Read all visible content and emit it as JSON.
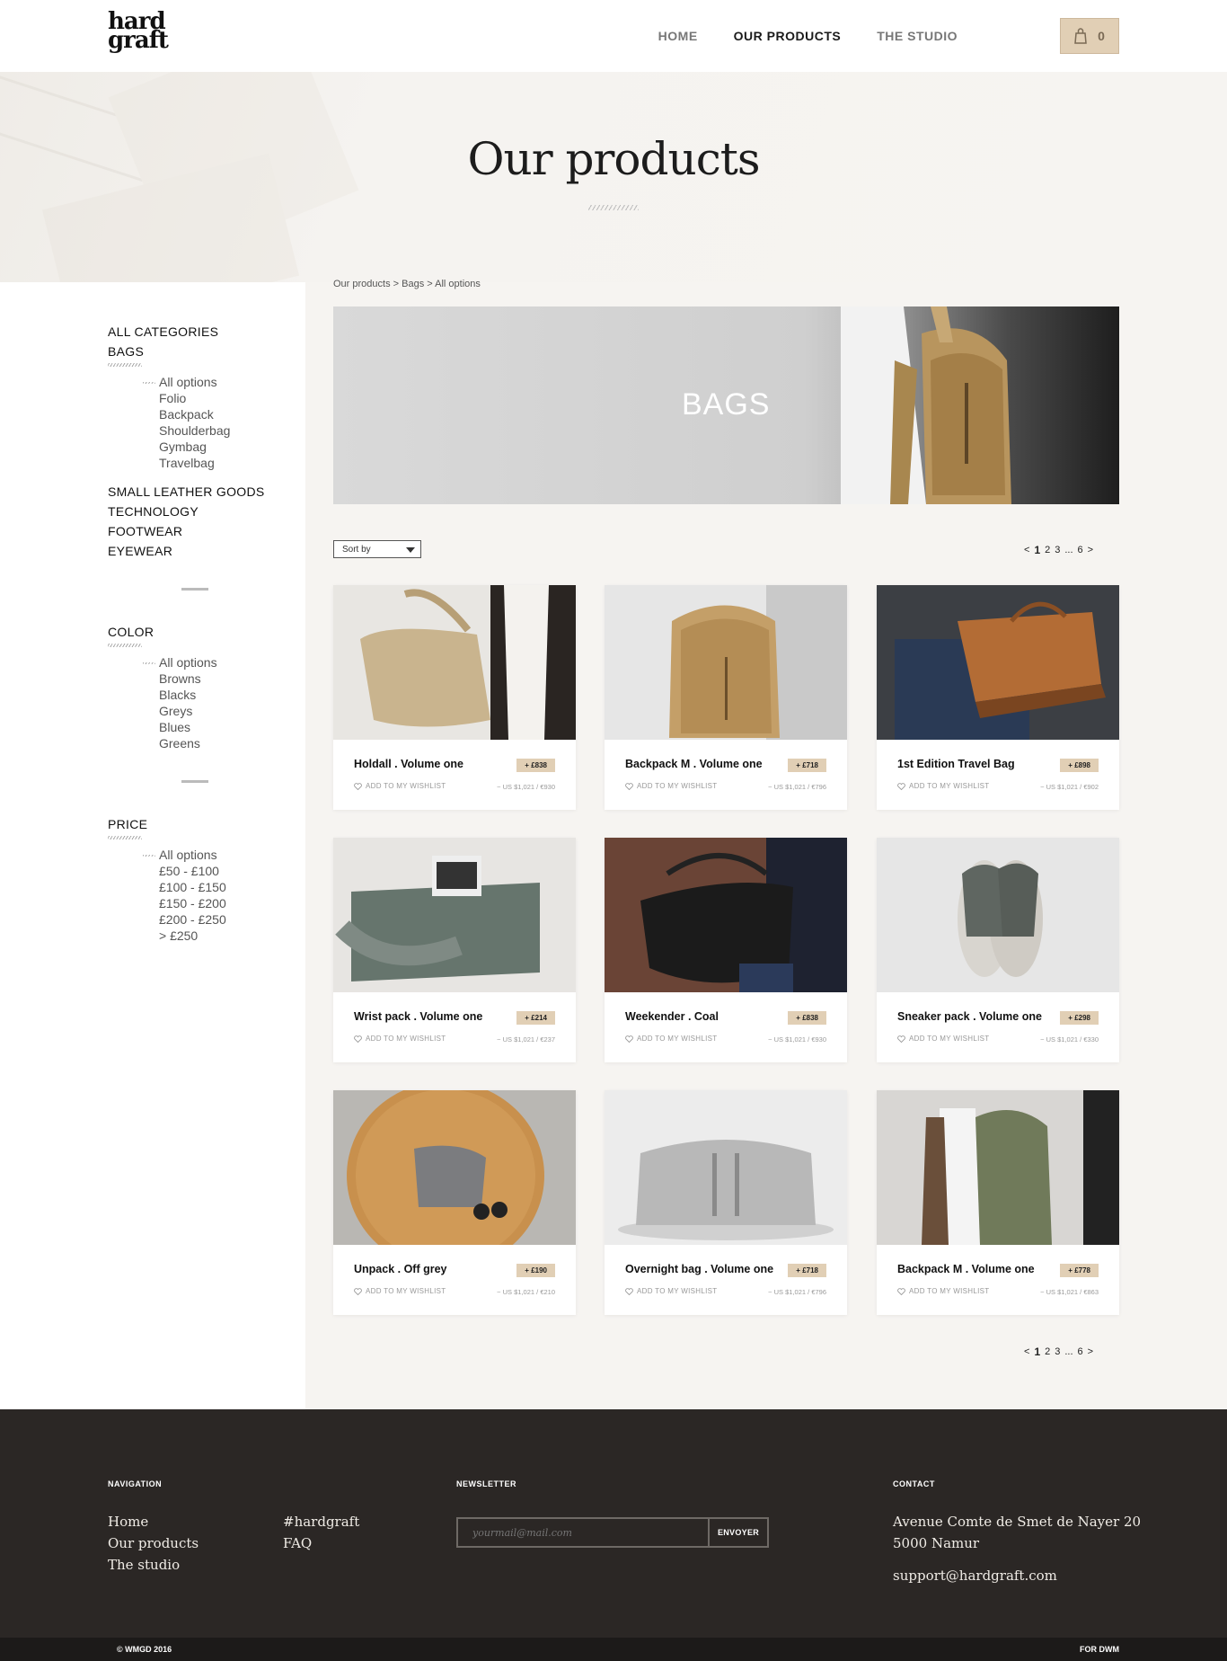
{
  "brand": {
    "logo_line1": "hard",
    "logo_line2": "graft"
  },
  "nav": {
    "home": "HOME",
    "products": "OUR PRODUCTS",
    "studio": "THE STUDIO",
    "cart_count": "0"
  },
  "hero": {
    "title": "Our products"
  },
  "breadcrumb": "Our products > Bags > All options",
  "sidebar": {
    "all_categories": "ALL CATEGORIES",
    "bags": "BAGS",
    "bag_options": [
      "All options",
      "Folio",
      "Backpack",
      "Shoulderbag",
      "Gymbag",
      "Travelbag"
    ],
    "other_categories": [
      "SMALL LEATHER GOODS",
      "TECHNOLOGY",
      "FOOTWEAR",
      "EYEWEAR"
    ],
    "color_title": "COLOR",
    "color_options": [
      "All options",
      "Browns",
      "Blacks",
      "Greys",
      "Blues",
      "Greens"
    ],
    "price_title": "PRICE",
    "price_options": [
      "All options",
      "£50 - £100",
      "£100 - £150",
      "£150 - £200",
      "£200 - £250",
      "> £250"
    ]
  },
  "banner": {
    "title": "BAGS"
  },
  "sort": {
    "label": "Sort by"
  },
  "pagination": {
    "prev": "<",
    "current": "1",
    "p2": "2",
    "p3": "3",
    "ellipsis": "...",
    "last": "6",
    "next": ">"
  },
  "wishlist_label": "ADD TO MY WISHLIST",
  "products": [
    {
      "name": "Holdall . Volume one",
      "price": "+ £838",
      "conv": "~ US $1,021 / €930"
    },
    {
      "name": "Backpack M . Volume one",
      "price": "+ £718",
      "conv": "~ US $1,021 / €796"
    },
    {
      "name": "1st Edition Travel Bag",
      "price": "+ £898",
      "conv": "~ US $1,021 / €902"
    },
    {
      "name": "Wrist pack . Volume one",
      "price": "+ £214",
      "conv": "~ US $1,021 / €237"
    },
    {
      "name": "Weekender . Coal",
      "price": "+ £838",
      "conv": "~ US $1,021 / €930"
    },
    {
      "name": "Sneaker pack . Volume one",
      "price": "+ £298",
      "conv": "~ US $1,021 / €330"
    },
    {
      "name": "Unpack . Off grey",
      "price": "+ £190",
      "conv": "~ US $1,021 / €210"
    },
    {
      "name": "Overnight bag . Volume one",
      "price": "+ £718",
      "conv": "~ US $1,021 / €796"
    },
    {
      "name": "Backpack M . Volume one",
      "price": "+ £778",
      "conv": "~ US $1,021 / €863"
    }
  ],
  "footer": {
    "nav_title": "NAVIGATION",
    "nav_links": [
      "Home",
      "Our products",
      "The studio"
    ],
    "nav_links2": [
      "#hardgraft",
      "FAQ"
    ],
    "newsletter_title": "NEWSLETTER",
    "newsletter_placeholder": "yourmail@mail.com",
    "newsletter_button": "ENVOYER",
    "contact_title": "CONTACT",
    "address1": "Avenue Comte de Smet de Nayer 20",
    "address2": "5000 Namur",
    "email": "support@hardgraft.com",
    "copyright": "© WMGD 2016",
    "credit": "FOR DWM"
  }
}
